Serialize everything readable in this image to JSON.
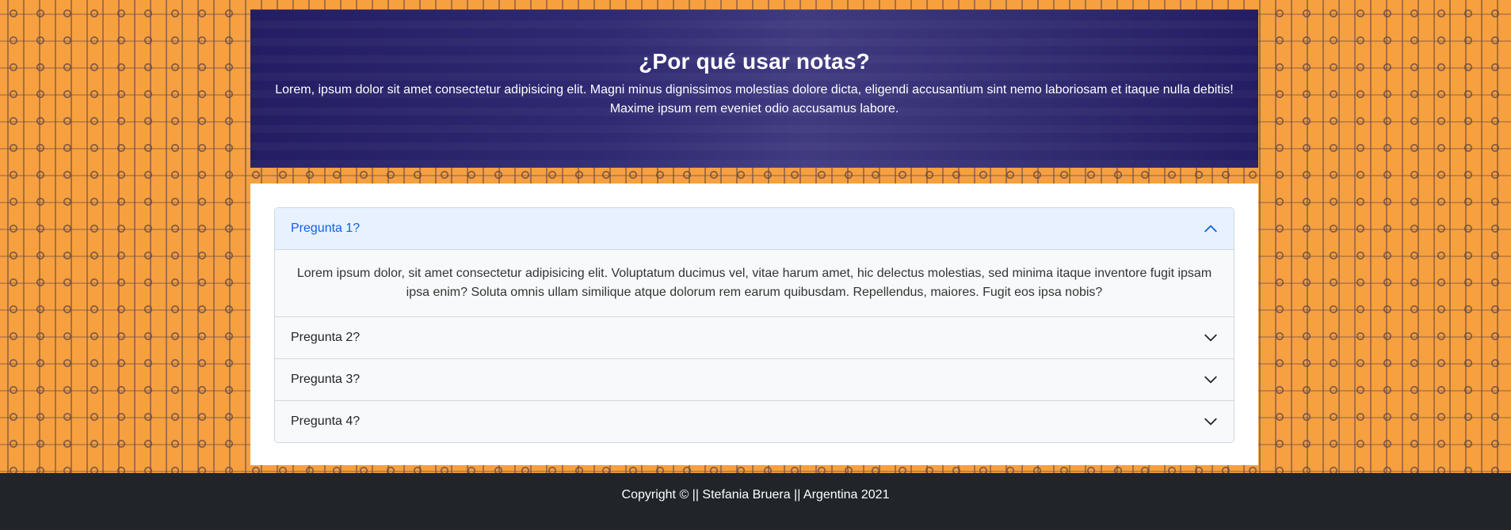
{
  "hero": {
    "title": "¿Por qué usar notas?",
    "text": "Lorem, ipsum dolor sit amet consectetur adipisicing elit. Magni minus dignissimos molestias dolore dicta, eligendi accusantium sint nemo laboriosam et itaque nulla debitis! Maxime ipsum rem eveniet odio accusamus labore."
  },
  "faq": {
    "items": [
      {
        "question": "Pregunta 1?",
        "expanded": true,
        "answer": "Lorem ipsum dolor, sit amet consectetur adipisicing elit. Voluptatum ducimus vel, vitae harum amet, hic delectus molestias, sed minima itaque inventore fugit ipsam ipsa enim? Soluta omnis ullam similique atque dolorum rem earum quibusdam. Repellendus, maiores. Fugit eos ipsa nobis?",
        "icon": "chevron-up-icon"
      },
      {
        "question": "Pregunta 2?",
        "expanded": false,
        "icon": "chevron-down-icon"
      },
      {
        "question": "Pregunta 3?",
        "expanded": false,
        "icon": "chevron-down-icon"
      },
      {
        "question": "Pregunta 4?",
        "expanded": false,
        "icon": "chevron-down-icon"
      }
    ]
  },
  "footer": {
    "text": "Copyright © || Stefania Bruera || Argentina 2021"
  },
  "colors": {
    "background_orange": "#f7a040",
    "hero_navy": "#221a5e",
    "accordion_active_bg": "#e7f1ff",
    "accordion_active_text": "#0c63e4",
    "footer_bg": "#212529"
  }
}
